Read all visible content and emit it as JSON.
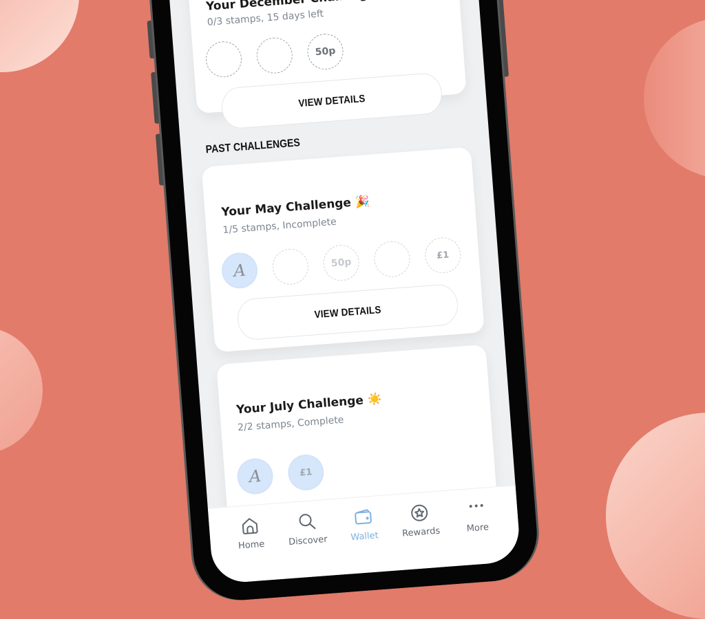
{
  "theme": {
    "background": "#e27b6a",
    "accent": "#7fb0e0",
    "stamp_filled": "#d6e6fb"
  },
  "current_challenge": {
    "title": "Your December Challenge",
    "subtitle": "0/3 stamps, 15 days left",
    "stamps": [
      {
        "label": "",
        "filled": false
      },
      {
        "label": "",
        "filled": false
      },
      {
        "label": "50p",
        "filled": false
      }
    ],
    "button_label": "VIEW DETAILS"
  },
  "past_section": {
    "heading": "PAST CHALLENGES"
  },
  "past_challenges": [
    {
      "title": "Your May Challenge",
      "emoji": "🎉",
      "subtitle": "1/5 stamps, Incomplete",
      "stamps": [
        {
          "label": "A",
          "filled": true
        },
        {
          "label": "",
          "filled": false
        },
        {
          "label": "50p",
          "filled": false
        },
        {
          "label": "",
          "filled": false
        },
        {
          "label": "£1",
          "filled": false
        }
      ],
      "button_label": "VIEW DETAILS"
    },
    {
      "title": "Your July Challenge",
      "emoji": "☀️",
      "subtitle": "2/2 stamps, Complete",
      "stamps": [
        {
          "label": "A",
          "filled": true
        },
        {
          "label": "£1",
          "filled": true
        }
      ]
    }
  ],
  "tabbar": {
    "items": [
      {
        "label": "Home",
        "icon": "home-icon",
        "active": false
      },
      {
        "label": "Discover",
        "icon": "search-icon",
        "active": false
      },
      {
        "label": "Wallet",
        "icon": "wallet-icon",
        "active": true
      },
      {
        "label": "Rewards",
        "icon": "star-badge-icon",
        "active": false
      },
      {
        "label": "More",
        "icon": "more-dots-icon",
        "active": false
      }
    ]
  }
}
